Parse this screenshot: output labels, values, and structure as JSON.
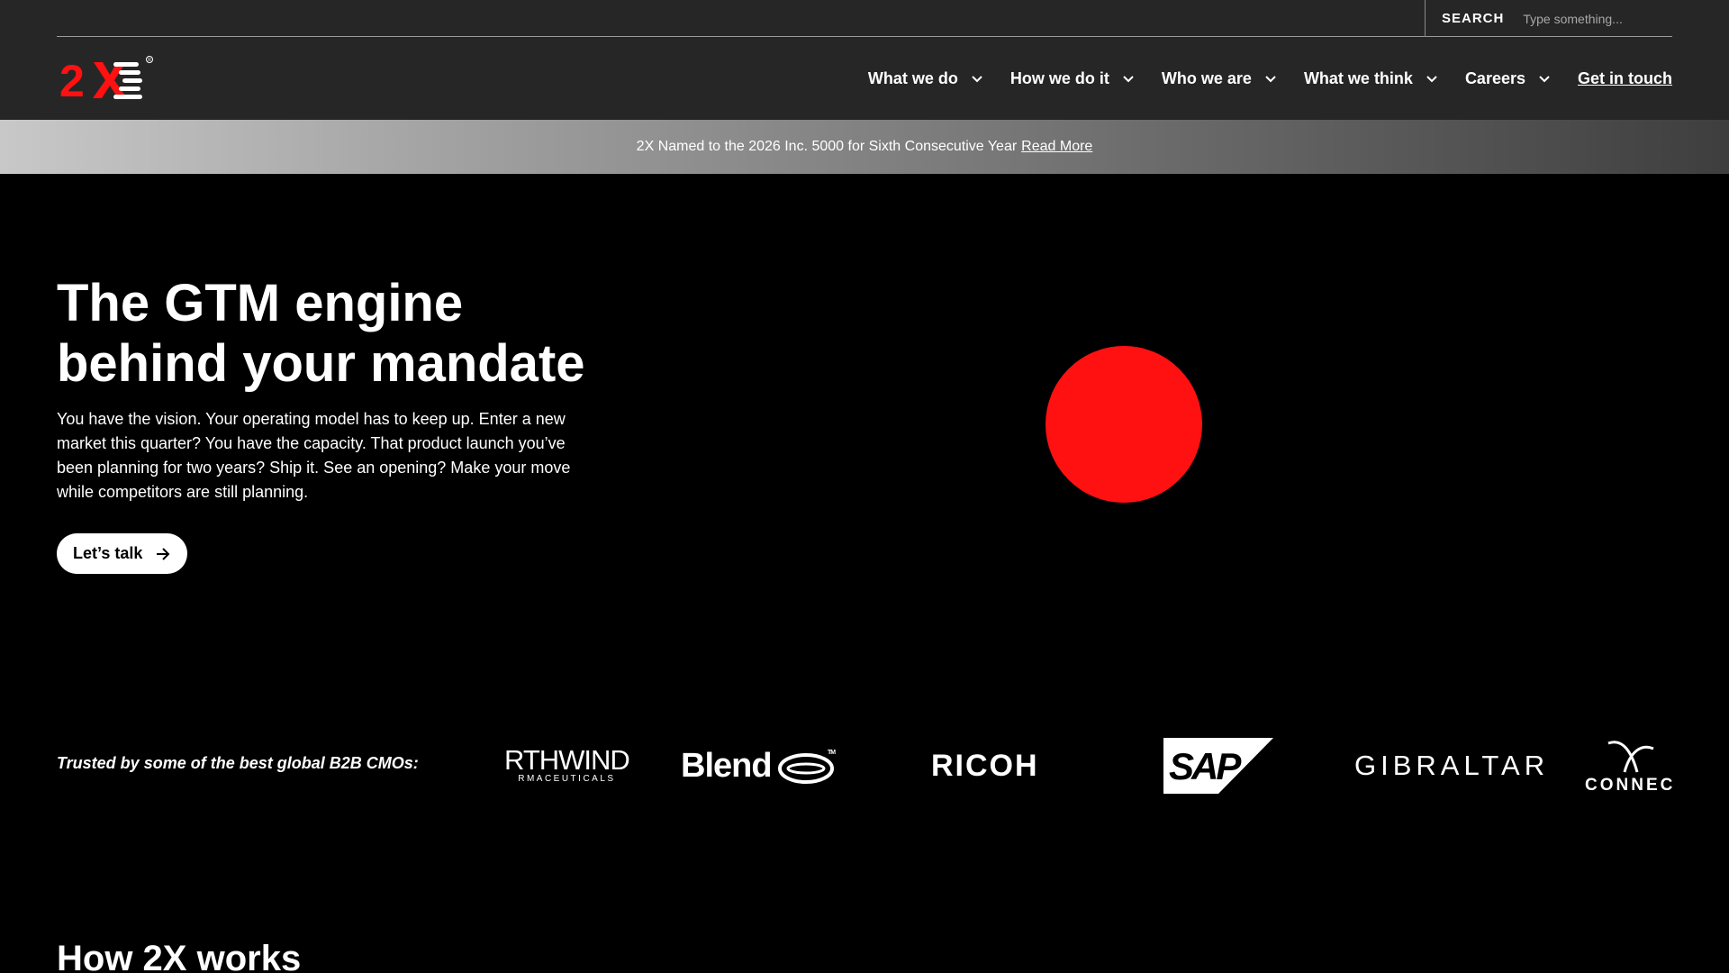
{
  "search": {
    "label": "SEARCH",
    "placeholder": "Type something..."
  },
  "nav": {
    "items": [
      {
        "label": "What we do"
      },
      {
        "label": "How we do it"
      },
      {
        "label": "Who we are"
      },
      {
        "label": "What we think"
      },
      {
        "label": "Careers"
      }
    ],
    "cta": "Get in touch"
  },
  "banner": {
    "text": "2X Named to the 2026 Inc. 5000 for Sixth Consecutive Year",
    "link": "Read More"
  },
  "hero": {
    "title_line1": "The GTM engine",
    "title_line2": "behind your mandate",
    "body": "You have the vision. Your operating model has to keep up. Enter a new market this quarter? You have the capacity. That product launch you’ve been planning for two years? Ship it. See an opening? Make your move while competitors are still planning.",
    "cta": "Let’s talk"
  },
  "trusted": {
    "label": "Trusted by some of the best global B2B CMOs:",
    "logos": {
      "northwind_big": "RTHWIND",
      "northwind_small": "RMACEUTICALS",
      "blend": "Blend",
      "ricoh": "RICOH",
      "sap": "SAP",
      "gibraltar": "GIBRALTAR",
      "connec": "CONNEC"
    }
  },
  "section": {
    "heading": "How 2X works"
  },
  "colors": {
    "header_bg": "#262626",
    "accent_red": "#ff1111",
    "page_bg": "#000000"
  }
}
